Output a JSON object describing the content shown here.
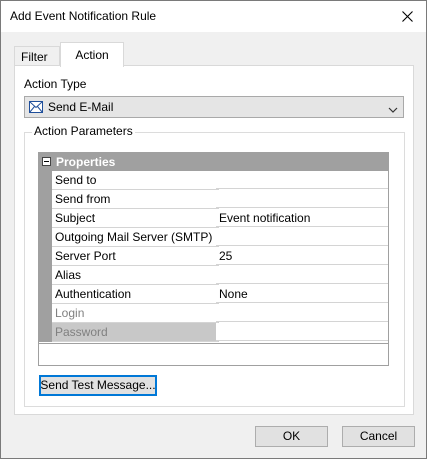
{
  "window": {
    "title": "Add Event Notification Rule"
  },
  "tabs": [
    {
      "label": "Filter",
      "selected": false
    },
    {
      "label": "Action",
      "selected": true
    }
  ],
  "action_type": {
    "label": "Action Type",
    "selected_value": "Send E-Mail",
    "icon": "mail-icon"
  },
  "action_parameters": {
    "label": "Action Parameters",
    "category": "Properties",
    "rows": [
      {
        "name": "Send to",
        "value": "",
        "enabled": true
      },
      {
        "name": "Send from",
        "value": "",
        "enabled": true
      },
      {
        "name": "Subject",
        "value": "Event notification",
        "enabled": true
      },
      {
        "name": "Outgoing Mail Server (SMTP)",
        "value": "",
        "enabled": true
      },
      {
        "name": "Server Port",
        "value": "25",
        "enabled": true
      },
      {
        "name": "Alias",
        "value": "",
        "enabled": true
      },
      {
        "name": "Authentication",
        "value": "None",
        "enabled": true
      },
      {
        "name": "Login",
        "value": "",
        "enabled": false
      },
      {
        "name": "Password",
        "value": "",
        "enabled": false
      }
    ],
    "test_button": "Send Test Message..."
  },
  "footer": {
    "ok": "OK",
    "cancel": "Cancel"
  }
}
